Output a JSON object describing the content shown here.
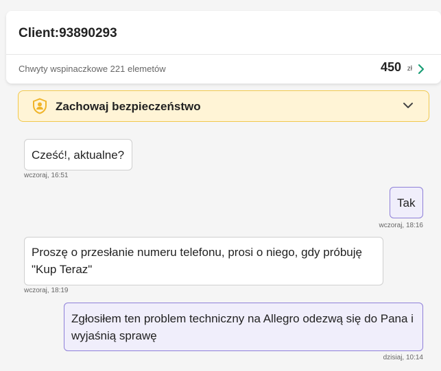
{
  "header": {
    "client_label": "Client:93890293",
    "offer_title": "Chwyty wspinaczkowe 221 elemetów",
    "price": "450",
    "currency": "zł"
  },
  "safety_banner": {
    "title": "Zachowaj bezpieczeństwo"
  },
  "messages": [
    {
      "direction": "in",
      "text": "Cześć!, aktualne?",
      "time": "wczoraj, 16:51"
    },
    {
      "direction": "out",
      "text": "Tak",
      "time": "wczoraj, 18:16"
    },
    {
      "direction": "in",
      "text": "Proszę o przesłanie numeru telefonu, prosi o niego, gdy próbuję \"Kup Teraz\"",
      "time": "wczoraj, 18:19"
    },
    {
      "direction": "out",
      "text": "Zgłosiłem ten problem techniczny na Allegro odezwą się do Pana i wyjaśnią sprawę",
      "time": "dzisiaj, 10:14"
    }
  ],
  "colors": {
    "accent_green": "#1a9e76",
    "banner_bg": "#fff4d6",
    "banner_border": "#f1c84b",
    "outgoing_bubble_bg": "#f0eefb",
    "outgoing_bubble_border": "#8e7fd8",
    "shield_yellow": "#f0b429"
  },
  "icons": {
    "offer_chevron": "chevron-right-icon",
    "safety": "shield-user-icon",
    "safety_toggle": "chevron-down-icon"
  }
}
